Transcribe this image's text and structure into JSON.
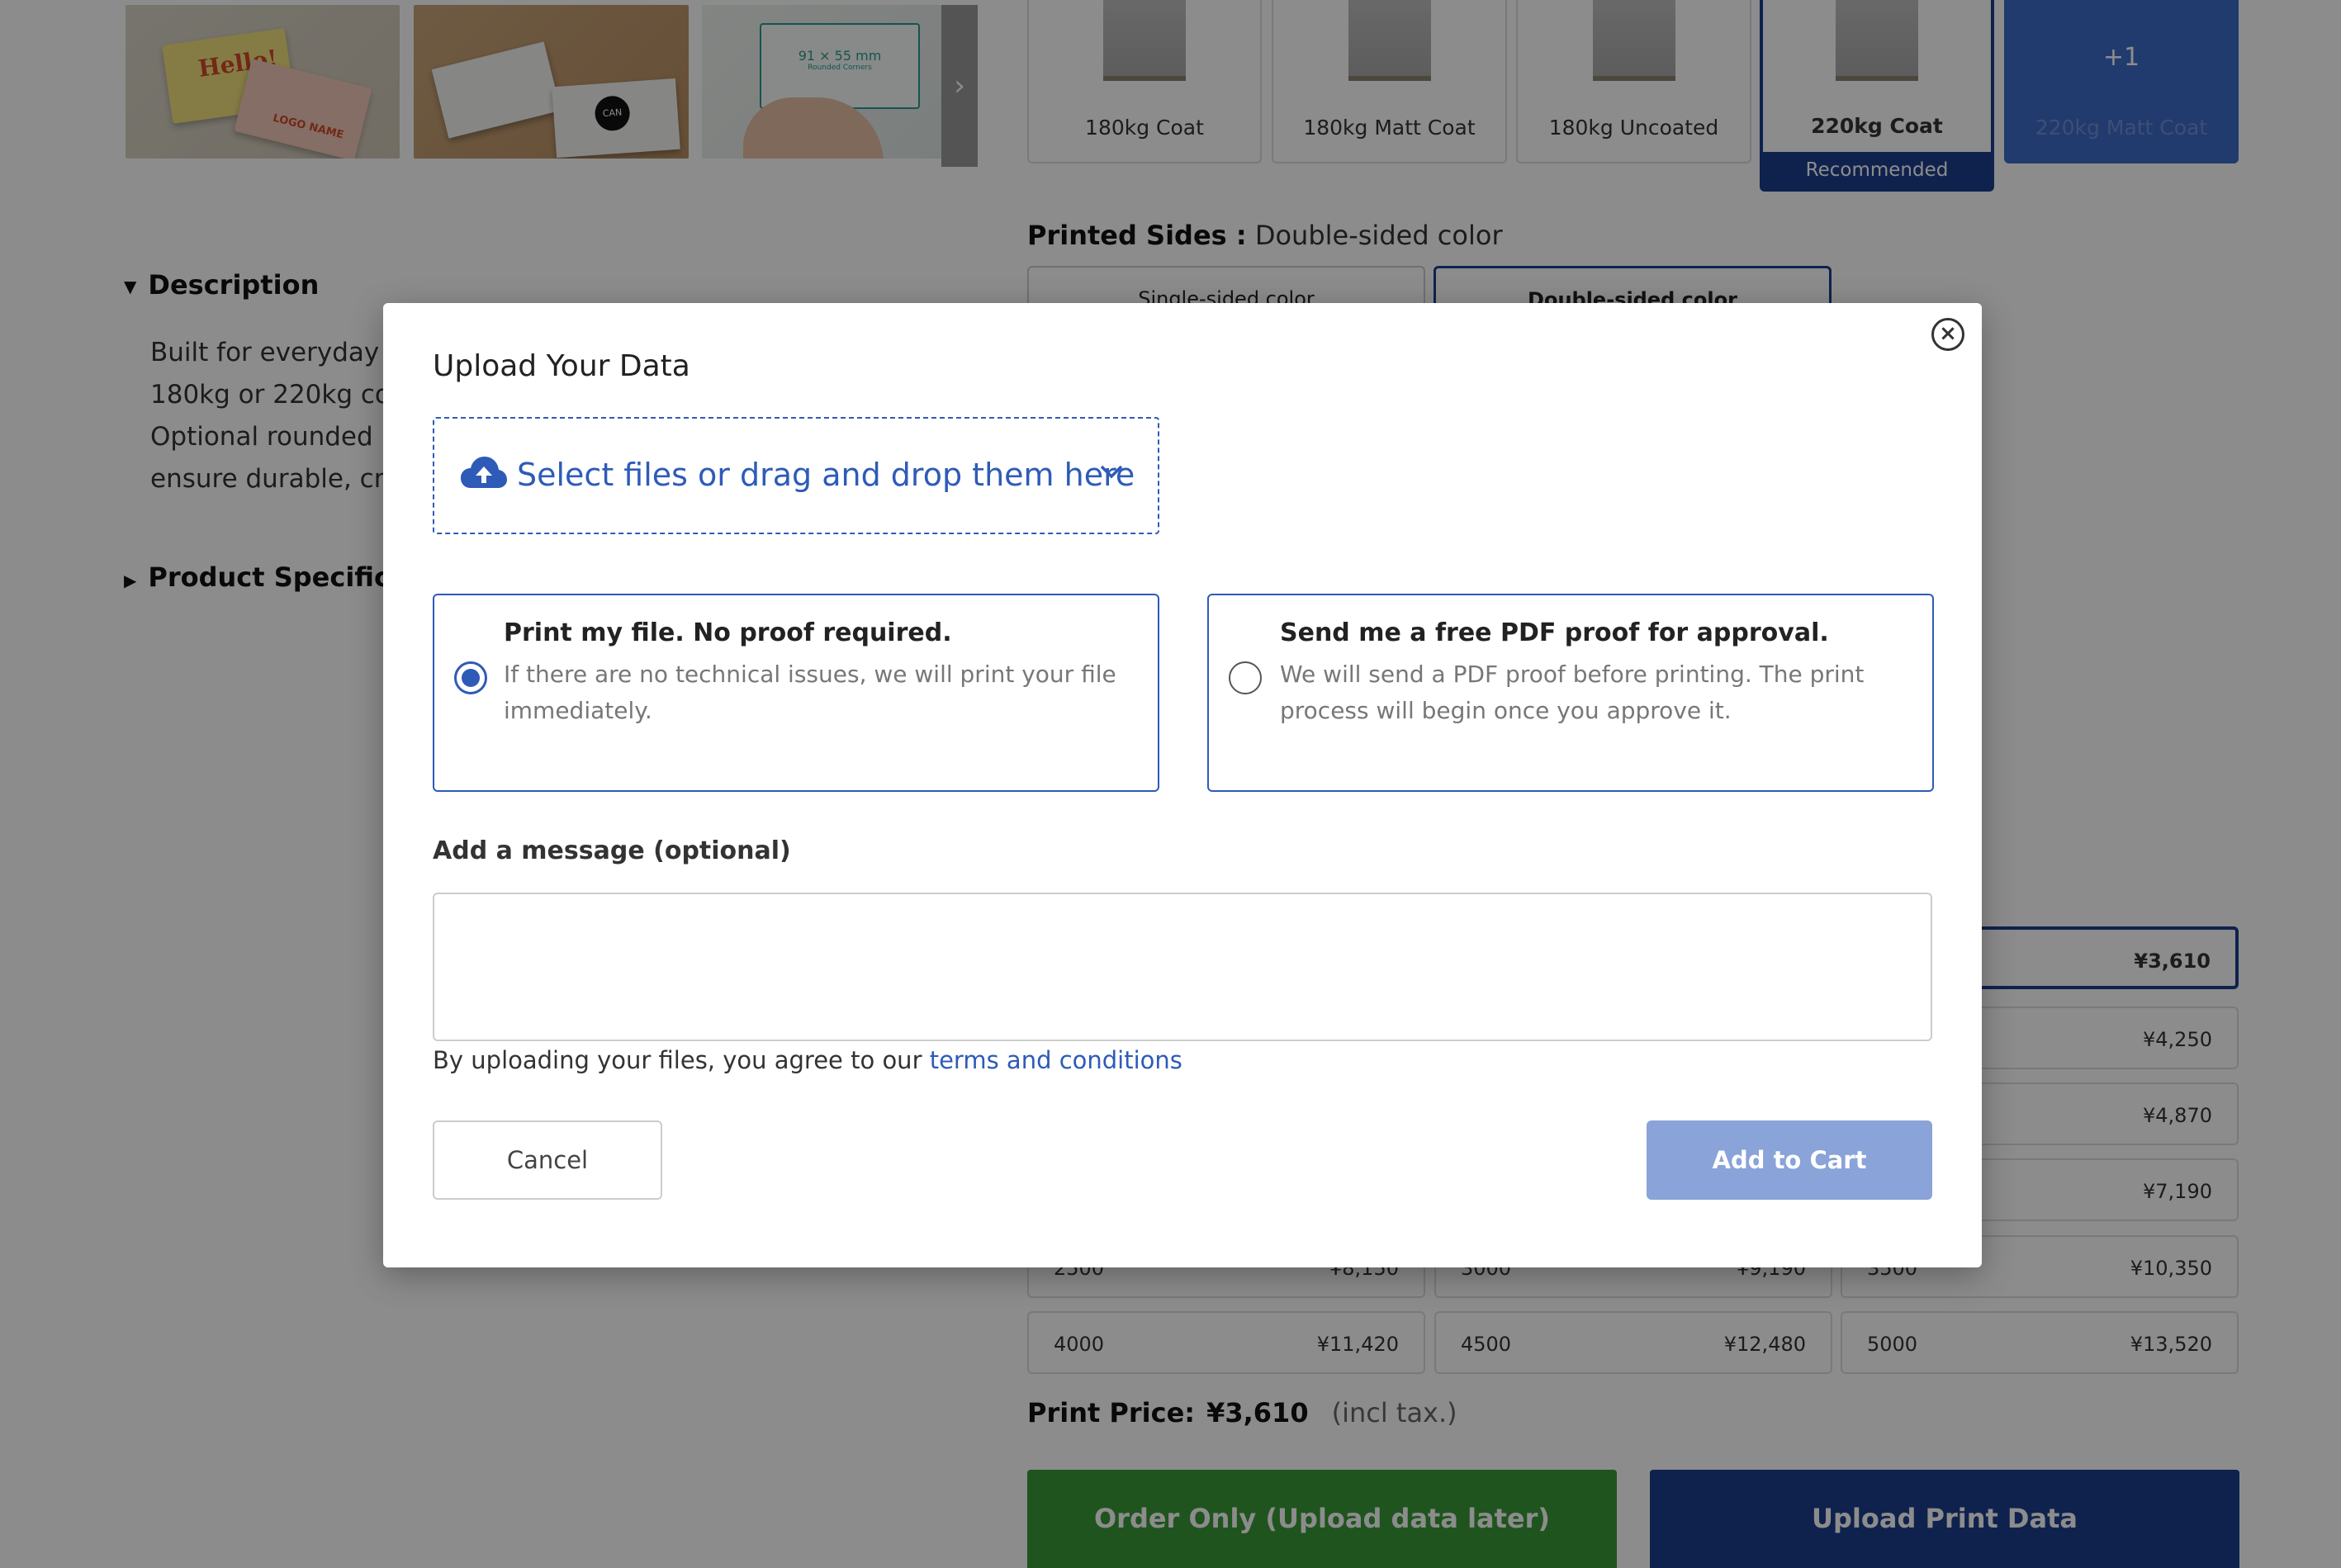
{
  "thumbnails": {
    "card1_text": "Hello!",
    "card2_text": "LOGO NAME",
    "card4_text": "CAN",
    "card5_big": "91 × 55 mm",
    "card5_small": "Rounded Corners",
    "next": "›"
  },
  "description": {
    "heading": "Description",
    "lines": [
      "Built for everyday",
      "180kg or 220kg co",
      "Optional rounded",
      "ensure durable, cr"
    ]
  },
  "specification": {
    "heading": "Product Specifica"
  },
  "paper_options": [
    {
      "label": "180kg Coat"
    },
    {
      "label": "180kg Matt Coat"
    },
    {
      "label": "180kg Uncoated"
    },
    {
      "label": "220kg Coat",
      "badge": "Recommended"
    },
    {
      "label": "220kg Matt Coat",
      "more": "+1"
    }
  ],
  "printed_sides": {
    "label": "Printed Sides :",
    "value": "Double-sided color",
    "options": [
      "Single-sided color",
      "Double-sided color"
    ]
  },
  "quantities": [
    {
      "qty": "",
      "price": "¥3,610"
    },
    {
      "qty": "",
      "price": "¥4,250"
    },
    {
      "qty": "",
      "price": "¥4,870"
    },
    {
      "qty": "",
      "price": "¥7,190"
    },
    {
      "qty": "2500",
      "price": "¥8,150"
    },
    {
      "qty": "3000",
      "price": "¥9,190"
    },
    {
      "qty": "3500",
      "price": "¥10,350"
    },
    {
      "qty": "4000",
      "price": "¥11,420"
    },
    {
      "qty": "4500",
      "price": "¥12,480"
    },
    {
      "qty": "5000",
      "price": "¥13,520"
    }
  ],
  "print_price": {
    "label": "Print Price:",
    "value": "¥3,610",
    "tax": "(incl tax.)"
  },
  "buttons": {
    "order_only": "Order Only (Upload data later)",
    "upload_print_data": "Upload Print Data"
  },
  "modal": {
    "title": "Upload Your Data",
    "close": "×",
    "dropzone": "Select files or drag and drop them here",
    "options": [
      {
        "title": "Print my file. No proof required.",
        "desc": "If there are no technical issues, we will print your file immediately.",
        "selected": true
      },
      {
        "title": "Send me a free PDF proof for approval.",
        "desc": "We will send a PDF proof before printing. The print process will begin once you approve it.",
        "selected": false
      }
    ],
    "message_label": "Add a message (optional)",
    "message_value": "",
    "agree_text": "By uploading your files, you agree to our",
    "agree_link": "terms and conditions",
    "cancel": "Cancel",
    "add_to_cart": "Add to Cart"
  },
  "colors": {
    "primary": "#1c3f8f",
    "link": "#2e5bb8",
    "order_green": "#3a9a3a",
    "add_to_cart_disabled": "#8aa3d8"
  }
}
